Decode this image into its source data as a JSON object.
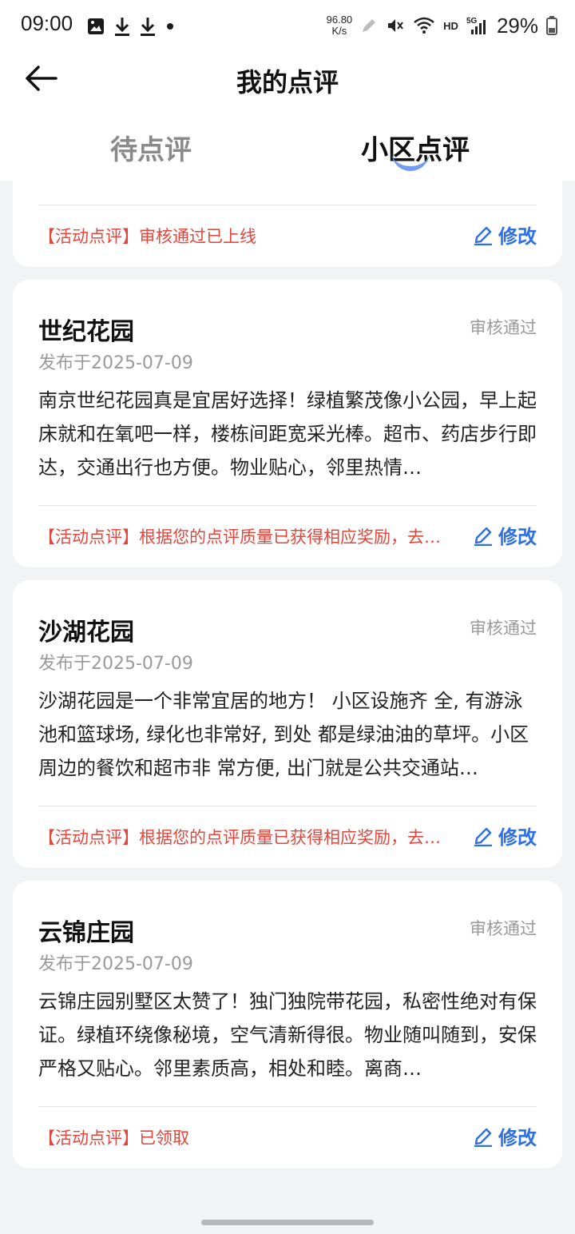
{
  "status_bar": {
    "time": "09:00",
    "net_speed_value": "96.80",
    "net_speed_unit": "K/s",
    "hd": "HD",
    "signal": "5G",
    "battery": "29%"
  },
  "header": {
    "title": "我的点评",
    "tabs": [
      {
        "label": "待点评",
        "active": false
      },
      {
        "label": "小区点评",
        "active": true
      }
    ]
  },
  "partial_card": {
    "note": "【活动点评】审核通过已上线",
    "edit_label": "修改"
  },
  "cards": [
    {
      "title": "世纪花园",
      "status": "审核通过",
      "date": "发布于2025-07-09",
      "body": "南京世纪花园真是宜居好选择！绿植繁茂像小公园，早上起床就和在氧吧一样，楼栋间距宽采光棒。超市、药店步行即达，交通出行也方便。物业贴心，邻里热情…",
      "note": "【活动点评】根据您的点评质量已获得相应奖励，去…",
      "edit_label": "修改"
    },
    {
      "title": "沙湖花园",
      "status": "审核通过",
      "date": "发布于2025-07-09",
      "body": "沙湖花园是一个非常宜居的地方！ 小区设施齐 全, 有游泳池和篮球场, 绿化也非常好, 到处 都是绿油油的草坪。小区周边的餐饮和超市非 常方便, 出门就是公共交通站…",
      "note": "【活动点评】根据您的点评质量已获得相应奖励，去…",
      "edit_label": "修改"
    },
    {
      "title": "云锦庄园",
      "status": "审核通过",
      "date": "发布于2025-07-09",
      "body": "云锦庄园别墅区太赞了！独门独院带花园，私密性绝对有保证。绿植环绕像秘境，空气清新得很。物业随叫随到，安保严格又贴心。邻里素质高，相处和睦。离商…",
      "note": "【活动点评】已领取",
      "edit_label": "修改"
    }
  ],
  "colors": {
    "accent": "#2f6fe6",
    "note_red": "#e2463c",
    "background": "#f2f3f5"
  }
}
